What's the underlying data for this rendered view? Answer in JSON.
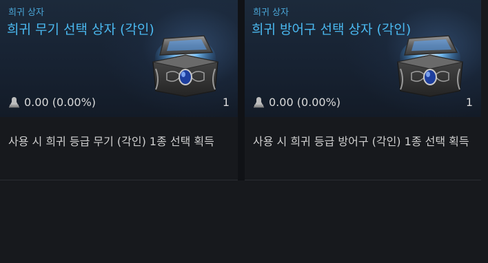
{
  "items": [
    {
      "category": "희귀 상자",
      "title": "희귀 무기 선택 상자 (각인)",
      "price": "0.00 (0.00%)",
      "count": "1",
      "description": "사용 시 희귀 등급 무기 (각인) 1종 선택 획득",
      "icon": "treasure-chest-icon"
    },
    {
      "category": "희귀 상자",
      "title": "희귀 방어구 선택 상자 (각인)",
      "price": "0.00 (0.00%)",
      "count": "1",
      "description": "사용 시 희귀 등급 방어구 (각인) 1종 선택 획득",
      "icon": "treasure-chest-icon"
    }
  ],
  "colors": {
    "category": "#4aa7d8",
    "title": "#4ab8ef",
    "text": "#d9d9d9",
    "background": "#17191d"
  }
}
